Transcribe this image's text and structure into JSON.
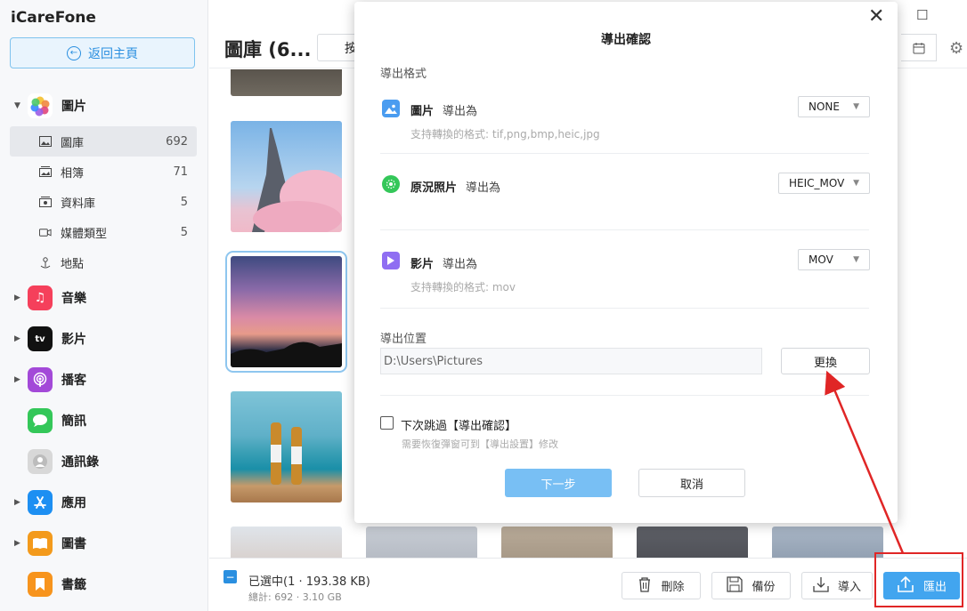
{
  "app": {
    "title": "iCareFone"
  },
  "sidebar": {
    "home_label": "返回主頁",
    "categories": [
      {
        "label": "圖片",
        "icon": "photos-icon",
        "expanded": true
      },
      {
        "label": "音樂",
        "icon": "music-icon"
      },
      {
        "label": "影片",
        "icon": "tv-icon"
      },
      {
        "label": "播客",
        "icon": "podcast-icon"
      },
      {
        "label": "簡訊",
        "icon": "messages-icon"
      },
      {
        "label": "通訊錄",
        "icon": "contacts-icon"
      },
      {
        "label": "應用",
        "icon": "appstore-icon"
      },
      {
        "label": "圖書",
        "icon": "books-icon"
      },
      {
        "label": "書籤",
        "icon": "bookmark-icon"
      }
    ],
    "photo_subitems": [
      {
        "label": "圖庫",
        "count": "692"
      },
      {
        "label": "相簿",
        "count": "71"
      },
      {
        "label": "資料庫",
        "count": "5"
      },
      {
        "label": "媒體類型",
        "count": "5"
      },
      {
        "label": "地點",
        "count": ""
      }
    ]
  },
  "main": {
    "title": "圖庫 (6...",
    "tab_label": "按"
  },
  "bottom": {
    "selected_text": "已選中(1 · 193.38 KB)",
    "total_text": "總計: 692 · 3.10 GB",
    "delete_label": "刪除",
    "backup_label": "備份",
    "import_label": "導入",
    "export_label": "匯出"
  },
  "dialog": {
    "title": "導出確認",
    "format_section": "導出格式",
    "export_as": "導出為",
    "rows": [
      {
        "name": "圖片",
        "value": "NONE",
        "hint": "支持轉換的格式: tif,png,bmp,heic,jpg"
      },
      {
        "name": "原況照片",
        "value": "HEIC_MOV",
        "hint": ""
      },
      {
        "name": "影片",
        "value": "MOV",
        "hint": "支持轉換的格式: mov"
      }
    ],
    "location_section": "導出位置",
    "path": "D:\\Users\\Pictures",
    "change_label": "更換",
    "skip_label": "下次跳過【導出確認】",
    "skip_hint": "需要恢復彈窗可到【導出設置】修改",
    "next_label": "下一步",
    "cancel_label": "取消"
  },
  "colors": {
    "accent": "#2a8fe0",
    "export_button": "#42a5ef",
    "annotation_red": "#e02626"
  }
}
